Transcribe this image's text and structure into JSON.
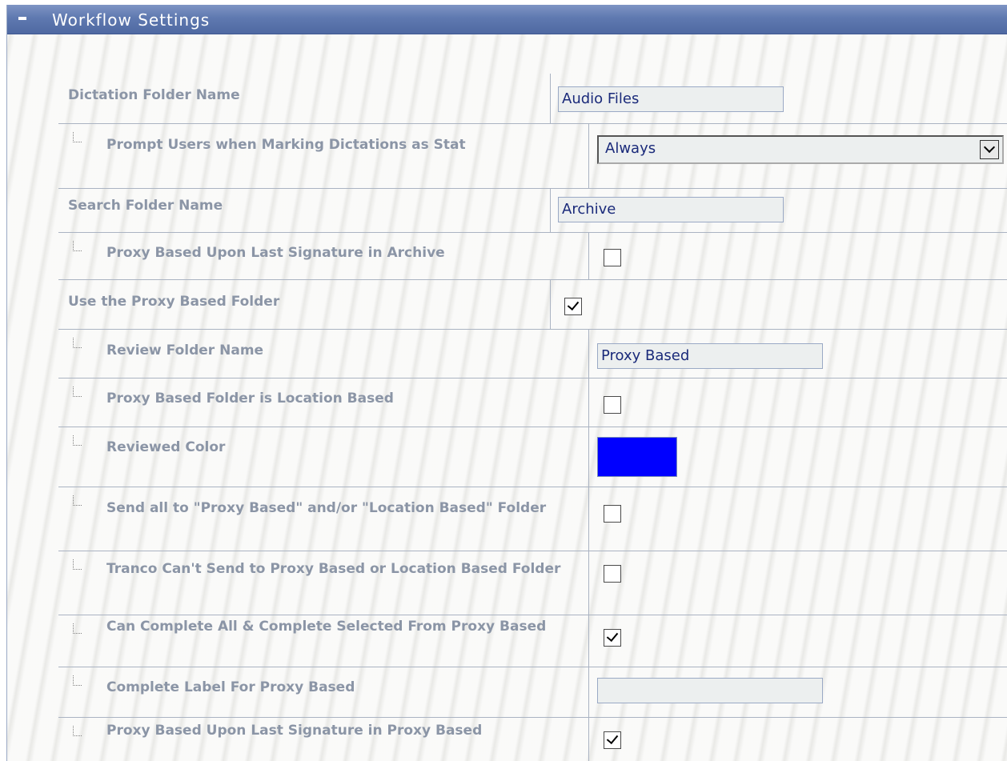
{
  "panel": {
    "title": "Workflow Settings",
    "collapse_icon": "minus-icon"
  },
  "settings": {
    "dictation_folder_name": {
      "label": "Dictation Folder Name",
      "value": "Audio Files"
    },
    "prompt_stat": {
      "label": "Prompt Users when Marking Dictations as Stat",
      "selected": "Always"
    },
    "search_folder_name": {
      "label": "Search Folder Name",
      "value": "Archive"
    },
    "proxy_last_sig_archive": {
      "label": "Proxy Based Upon Last Signature in Archive",
      "checked": false
    },
    "use_proxy_folder": {
      "label": "Use the Proxy Based Folder",
      "checked": true
    },
    "review_folder_name": {
      "label": "Review Folder Name",
      "value": "Proxy Based"
    },
    "proxy_location_based": {
      "label": "Proxy Based Folder is Location Based",
      "checked": false
    },
    "reviewed_color": {
      "label": "Reviewed Color",
      "color": "#0000ff"
    },
    "send_all_proxy": {
      "label": "Send all to \"Proxy Based\" and/or \"Location Based\" Folder",
      "checked": false
    },
    "tranco_cant_send": {
      "label": "Tranco Can't Send to Proxy Based or Location Based Folder",
      "checked": false
    },
    "complete_all_selected": {
      "label": "Can Complete All & Complete Selected From Proxy Based",
      "checked": true
    },
    "complete_label": {
      "label": "Complete Label For Proxy Based",
      "value": ""
    },
    "proxy_last_sig_proxy": {
      "label": "Proxy Based Upon Last Signature in Proxy Based",
      "checked": true
    }
  }
}
